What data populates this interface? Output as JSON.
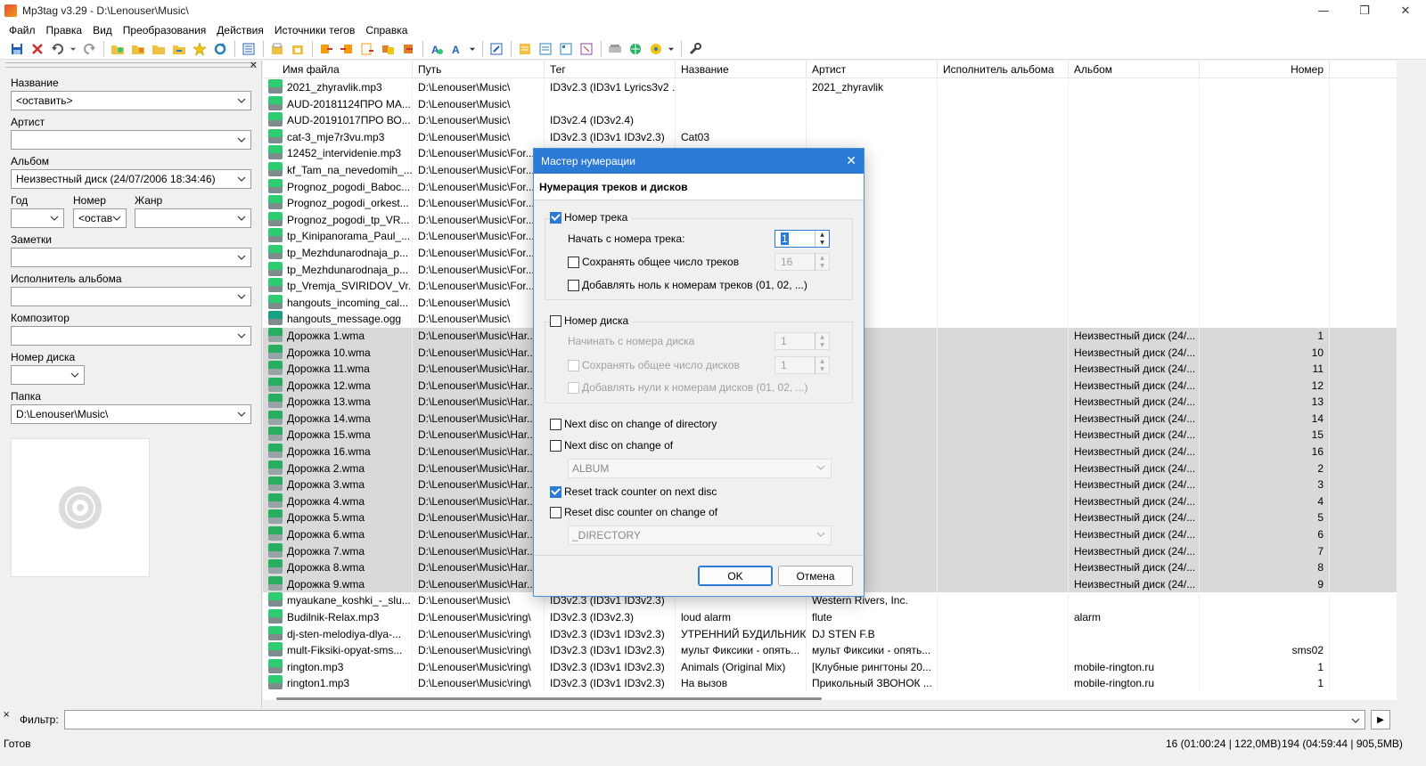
{
  "window": {
    "title": "Mp3tag v3.29  -  D:\\Lenouser\\Music\\",
    "minimize": "—",
    "maximize": "❐",
    "close": "✕"
  },
  "menu": [
    "Файл",
    "Правка",
    "Вид",
    "Преобразования",
    "Действия",
    "Источники тегов",
    "Справка"
  ],
  "tag_panel": {
    "close": "×",
    "title_label": "Название",
    "title_value": "<оставить>",
    "artist_label": "Артист",
    "artist_value": "",
    "album_label": "Альбом",
    "album_value": "Неизвестный диск (24/07/2006 18:34:46)",
    "year_label": "Год",
    "year_value": "",
    "track_label": "Номер",
    "track_value": "<оставить>",
    "genre_label": "Жанр",
    "genre_value": "",
    "comment_label": "Заметки",
    "comment_value": "",
    "album_artist_label": "Исполнитель альбома",
    "album_artist_value": "",
    "composer_label": "Композитор",
    "composer_value": "",
    "disc_label": "Номер диска",
    "disc_value": "",
    "folder_label": "Папка",
    "folder_value": "D:\\Lenouser\\Music\\"
  },
  "columns": [
    "Имя файла",
    "Путь",
    "Тег",
    "Название",
    "Артист",
    "Исполнитель альбома",
    "Альбом",
    "Номер"
  ],
  "rows": [
    {
      "icon": "mp3",
      "file": "2021_zhyravlik.mp3",
      "path": "D:\\Lenouser\\Music\\",
      "tag": "ID3v2.3 (ID3v1 Lyrics3v2 ...",
      "title": "",
      "artist": "2021_zhyravlik",
      "aa": "",
      "album": "",
      "num": "",
      "sel": false
    },
    {
      "icon": "mp3",
      "file": "AUD-20181124ПРО МА...",
      "path": "D:\\Lenouser\\Music\\",
      "tag": "",
      "title": "",
      "artist": "",
      "aa": "",
      "album": "",
      "num": "",
      "sel": false
    },
    {
      "icon": "mp3",
      "file": "AUD-20191017ПРО ВО...",
      "path": "D:\\Lenouser\\Music\\",
      "tag": "ID3v2.4 (ID3v2.4)",
      "title": "",
      "artist": "",
      "aa": "",
      "album": "",
      "num": "",
      "sel": false
    },
    {
      "icon": "mp3",
      "file": "cat-3_mje7r3vu.mp3",
      "path": "D:\\Lenouser\\Music\\",
      "tag": "ID3v2.3 (ID3v1 ID3v2.3)",
      "title": "Cat03",
      "artist": "",
      "aa": "",
      "album": "",
      "num": "",
      "sel": false
    },
    {
      "icon": "mp3",
      "file": "12452_intervidenie.mp3",
      "path": "D:\\Lenouser\\Music\\For...",
      "tag": "",
      "title": "",
      "artist": "",
      "aa": "",
      "album": "",
      "num": "",
      "sel": false
    },
    {
      "icon": "mp3",
      "file": "kf_Tam_na_nevedomih_...",
      "path": "D:\\Lenouser\\Music\\For...",
      "tag": "",
      "title": "",
      "artist": "",
      "aa": "",
      "album": "",
      "num": "",
      "sel": false
    },
    {
      "icon": "mp3",
      "file": "Prognoz_pogodi_Baboc...",
      "path": "D:\\Lenouser\\Music\\For...",
      "tag": "",
      "title": "",
      "artist": "",
      "aa": "",
      "album": "",
      "num": "",
      "sel": false
    },
    {
      "icon": "mp3",
      "file": "Prognoz_pogodi_orkest...",
      "path": "D:\\Lenouser\\Music\\For...",
      "tag": "",
      "title": "",
      "artist": "",
      "aa": "",
      "album": "",
      "num": "",
      "sel": false
    },
    {
      "icon": "mp3",
      "file": "Prognoz_pogodi_tp_VR...",
      "path": "D:\\Lenouser\\Music\\For...",
      "tag": "",
      "title": "",
      "artist": "",
      "aa": "",
      "album": "",
      "num": "",
      "sel": false
    },
    {
      "icon": "mp3",
      "file": "tp_Kinipanorama_Paul_...",
      "path": "D:\\Lenouser\\Music\\For...",
      "tag": "",
      "title": "",
      "artist": "",
      "aa": "",
      "album": "",
      "num": "",
      "sel": false
    },
    {
      "icon": "mp3",
      "file": "tp_Mezhdunarodnaja_p...",
      "path": "D:\\Lenouser\\Music\\For...",
      "tag": "",
      "title": "",
      "artist": "",
      "aa": "",
      "album": "",
      "num": "",
      "sel": false
    },
    {
      "icon": "mp3",
      "file": "tp_Mezhdunarodnaja_p...",
      "path": "D:\\Lenouser\\Music\\For...",
      "tag": "",
      "title": "",
      "artist": "",
      "aa": "",
      "album": "",
      "num": "",
      "sel": false
    },
    {
      "icon": "mp3",
      "file": "tp_Vremja_SVIRIDOV_Vr...",
      "path": "D:\\Lenouser\\Music\\For...",
      "tag": "",
      "title": "",
      "artist": "",
      "aa": "",
      "album": "",
      "num": "",
      "sel": false
    },
    {
      "icon": "mp3",
      "file": "hangouts_incoming_cal...",
      "path": "D:\\Lenouser\\Music\\",
      "tag": "",
      "title": "",
      "artist": "",
      "aa": "",
      "album": "",
      "num": "",
      "sel": false
    },
    {
      "icon": "ogg",
      "file": "hangouts_message.ogg",
      "path": "D:\\Lenouser\\Music\\",
      "tag": "",
      "title": "",
      "artist": "",
      "aa": "",
      "album": "",
      "num": "",
      "sel": false
    },
    {
      "icon": "wma",
      "file": "Дорожка 1.wma",
      "path": "D:\\Lenouser\\Music\\Har...",
      "tag": "",
      "title": "",
      "artist": "",
      "aa": "",
      "album": "Неизвестный диск (24/...",
      "num": "1",
      "sel": true
    },
    {
      "icon": "wma",
      "file": "Дорожка 10.wma",
      "path": "D:\\Lenouser\\Music\\Har...",
      "tag": "",
      "title": "",
      "artist": "",
      "aa": "",
      "album": "Неизвестный диск (24/...",
      "num": "10",
      "sel": true
    },
    {
      "icon": "wma",
      "file": "Дорожка 11.wma",
      "path": "D:\\Lenouser\\Music\\Har...",
      "tag": "",
      "title": "",
      "artist": "",
      "aa": "",
      "album": "Неизвестный диск (24/...",
      "num": "11",
      "sel": true
    },
    {
      "icon": "wma",
      "file": "Дорожка 12.wma",
      "path": "D:\\Lenouser\\Music\\Har...",
      "tag": "",
      "title": "",
      "artist": "",
      "aa": "",
      "album": "Неизвестный диск (24/...",
      "num": "12",
      "sel": true
    },
    {
      "icon": "wma",
      "file": "Дорожка 13.wma",
      "path": "D:\\Lenouser\\Music\\Har...",
      "tag": "",
      "title": "",
      "artist": "",
      "aa": "",
      "album": "Неизвестный диск (24/...",
      "num": "13",
      "sel": true
    },
    {
      "icon": "wma",
      "file": "Дорожка 14.wma",
      "path": "D:\\Lenouser\\Music\\Har...",
      "tag": "",
      "title": "",
      "artist": "",
      "aa": "",
      "album": "Неизвестный диск (24/...",
      "num": "14",
      "sel": true
    },
    {
      "icon": "wma",
      "file": "Дорожка 15.wma",
      "path": "D:\\Lenouser\\Music\\Har...",
      "tag": "",
      "title": "",
      "artist": "",
      "aa": "",
      "album": "Неизвестный диск (24/...",
      "num": "15",
      "sel": true
    },
    {
      "icon": "wma",
      "file": "Дорожка 16.wma",
      "path": "D:\\Lenouser\\Music\\Har...",
      "tag": "",
      "title": "",
      "artist": "",
      "aa": "",
      "album": "Неизвестный диск (24/...",
      "num": "16",
      "sel": true
    },
    {
      "icon": "wma",
      "file": "Дорожка 2.wma",
      "path": "D:\\Lenouser\\Music\\Har...",
      "tag": "",
      "title": "",
      "artist": "",
      "aa": "",
      "album": "Неизвестный диск (24/...",
      "num": "2",
      "sel": true
    },
    {
      "icon": "wma",
      "file": "Дорожка 3.wma",
      "path": "D:\\Lenouser\\Music\\Har...",
      "tag": "",
      "title": "",
      "artist": "",
      "aa": "",
      "album": "Неизвестный диск (24/...",
      "num": "3",
      "sel": true
    },
    {
      "icon": "wma",
      "file": "Дорожка 4.wma",
      "path": "D:\\Lenouser\\Music\\Har...",
      "tag": "",
      "title": "",
      "artist": "",
      "aa": "",
      "album": "Неизвестный диск (24/...",
      "num": "4",
      "sel": true
    },
    {
      "icon": "wma",
      "file": "Дорожка 5.wma",
      "path": "D:\\Lenouser\\Music\\Har...",
      "tag": "",
      "title": "",
      "artist": "",
      "aa": "",
      "album": "Неизвестный диск (24/...",
      "num": "5",
      "sel": true
    },
    {
      "icon": "wma",
      "file": "Дорожка 6.wma",
      "path": "D:\\Lenouser\\Music\\Har...",
      "tag": "",
      "title": "",
      "artist": "",
      "aa": "",
      "album": "Неизвестный диск (24/...",
      "num": "6",
      "sel": true
    },
    {
      "icon": "wma",
      "file": "Дорожка 7.wma",
      "path": "D:\\Lenouser\\Music\\Har...",
      "tag": "",
      "title": "",
      "artist": "",
      "aa": "",
      "album": "Неизвестный диск (24/...",
      "num": "7",
      "sel": true
    },
    {
      "icon": "wma",
      "file": "Дорожка 8.wma",
      "path": "D:\\Lenouser\\Music\\Har...",
      "tag": "",
      "title": "",
      "artist": "",
      "aa": "",
      "album": "Неизвестный диск (24/...",
      "num": "8",
      "sel": true
    },
    {
      "icon": "wma",
      "file": "Дорожка 9.wma",
      "path": "D:\\Lenouser\\Music\\Har...",
      "tag": "",
      "title": "",
      "artist": "",
      "aa": "",
      "album": "Неизвестный диск (24/...",
      "num": "9",
      "sel": true
    },
    {
      "icon": "mp3",
      "file": "myaukane_koshki_-_slu...",
      "path": "D:\\Lenouser\\Music\\",
      "tag": "ID3v2.3 (ID3v1 ID3v2.3)",
      "title": "",
      "artist": "Western Rivers, Inc.",
      "aa": "",
      "album": "",
      "num": "",
      "sel": false
    },
    {
      "icon": "mp3",
      "file": "Budilnik-Relax.mp3",
      "path": "D:\\Lenouser\\Music\\ring\\",
      "tag": "ID3v2.3 (ID3v2.3)",
      "title": "loud alarm",
      "artist": "flute",
      "aa": "",
      "album": "alarm",
      "num": "",
      "sel": false
    },
    {
      "icon": "mp3",
      "file": "dj-sten-melodiya-dlya-...",
      "path": "D:\\Lenouser\\Music\\ring\\",
      "tag": "ID3v2.3 (ID3v1 ID3v2.3)",
      "title": "УТРЕННИЙ БУДИЛЬНИК",
      "artist": "DJ STEN F.B",
      "aa": "",
      "album": "",
      "num": "",
      "sel": false
    },
    {
      "icon": "mp3",
      "file": "mult-Fiksiki-opyat-sms...",
      "path": "D:\\Lenouser\\Music\\ring\\",
      "tag": "ID3v2.3 (ID3v1 ID3v2.3)",
      "title": "мульт Фиксики - опять...",
      "artist": "мульт Фиксики - опять...",
      "aa": "",
      "album": "",
      "num": "sms02",
      "sel": false
    },
    {
      "icon": "mp3",
      "file": "rington.mp3",
      "path": "D:\\Lenouser\\Music\\ring\\",
      "tag": "ID3v2.3 (ID3v1 ID3v2.3)",
      "title": "Animals (Original Mix)",
      "artist": "[Клубные рингтоны 20...",
      "aa": "",
      "album": "mobile-rington.ru",
      "num": "1",
      "sel": false
    },
    {
      "icon": "mp3",
      "file": "rington1.mp3",
      "path": "D:\\Lenouser\\Music\\ring\\",
      "tag": "ID3v2.3 (ID3v1 ID3v2.3)",
      "title": "На вызов",
      "artist": "Прикольный ЗВОНОК ...",
      "aa": "",
      "album": "mobile-rington.ru",
      "num": "1",
      "sel": false
    }
  ],
  "filter": {
    "close": "×",
    "label": "Фильтр:",
    "value": "",
    "go": "▶"
  },
  "status": {
    "left": "Готов",
    "selected": "16 (01:00:24 | 122,0MB)",
    "total": "194 (04:59:44 | 905,5MB)"
  },
  "dialog": {
    "title": "Мастер нумерации",
    "close": "✕",
    "header": "Нумерация треков и дисков",
    "track_number_label": "Номер трека",
    "track_number_checked": true,
    "start_track_label": "Начать с номера трека:",
    "start_track_value": "1",
    "keep_total_tracks_label": "Сохранять общее число треков",
    "keep_total_tracks_checked": false,
    "total_tracks_value": "16",
    "pad_tracks_label": "Добавлять ноль к номерам треков (01, 02, ...)",
    "pad_tracks_checked": false,
    "disc_number_label": "Номер диска",
    "disc_number_checked": false,
    "start_disc_label": "Начинать с номера диска",
    "start_disc_value": "1",
    "keep_total_discs_label": "Сохранять общее число дисков",
    "keep_total_discs_checked": false,
    "total_discs_value": "1",
    "pad_discs_label": "Добавлять нули к номерам дисков (01, 02, ...)",
    "pad_discs_checked": false,
    "next_disc_dir_label": "Next disc on change of directory",
    "next_disc_dir_checked": false,
    "next_disc_change_label": "Next disc on change of",
    "next_disc_change_checked": false,
    "next_disc_change_value": "ALBUM",
    "reset_track_label": "Reset track counter on next disc",
    "reset_track_checked": true,
    "reset_disc_label": "Reset disc counter on change of",
    "reset_disc_checked": false,
    "reset_disc_value": "_DIRECTORY",
    "ok_label": "OK",
    "cancel_label": "Отмена"
  },
  "colors": {
    "accent": "#2b7ad6",
    "selection": "#d9d9d9"
  }
}
